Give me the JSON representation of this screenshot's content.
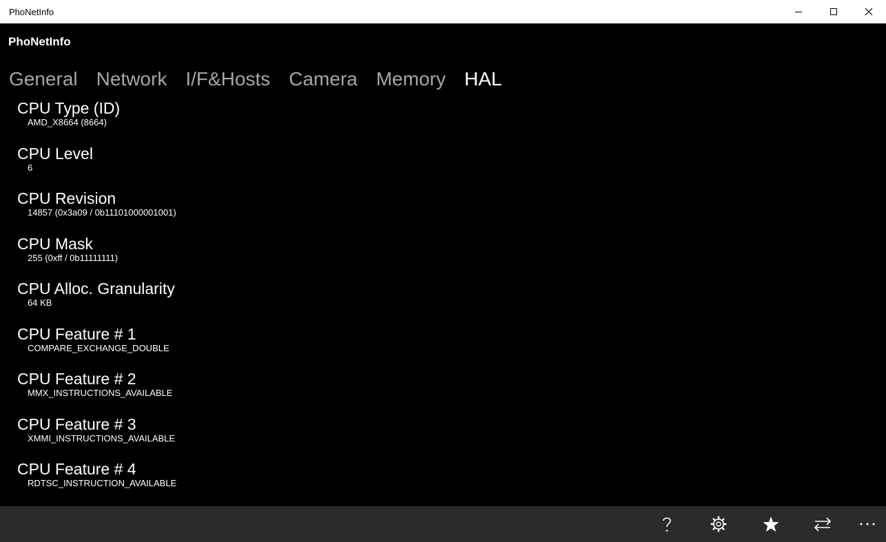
{
  "window": {
    "title": "PhoNetInfo"
  },
  "app": {
    "title": "PhoNetInfo"
  },
  "tabs": [
    {
      "label": "General"
    },
    {
      "label": "Network"
    },
    {
      "label": "I/F&Hosts"
    },
    {
      "label": "Camera"
    },
    {
      "label": "Memory"
    },
    {
      "label": "HAL"
    }
  ],
  "active_tab": "HAL",
  "items": [
    {
      "title": "CPU Type (ID)",
      "value": "AMD_X8664 (8664)"
    },
    {
      "title": "CPU Level",
      "value": "6"
    },
    {
      "title": "CPU Revision",
      "value": "14857 (0x3a09 / 0b11101000001001)"
    },
    {
      "title": "CPU Mask",
      "value": "255 (0xff / 0b11111111)"
    },
    {
      "title": "CPU Alloc. Granularity",
      "value": "64 KB"
    },
    {
      "title": "CPU Feature # 1",
      "value": "COMPARE_EXCHANGE_DOUBLE"
    },
    {
      "title": "CPU Feature # 2",
      "value": "MMX_INSTRUCTIONS_AVAILABLE"
    },
    {
      "title": "CPU Feature # 3",
      "value": "XMMI_INSTRUCTIONS_AVAILABLE"
    },
    {
      "title": "CPU Feature # 4",
      "value": "RDTSC_INSTRUCTION_AVAILABLE"
    }
  ],
  "appbar": {
    "icons": [
      "help-icon",
      "settings-icon",
      "favorite-icon",
      "swap-icon",
      "more-icon"
    ]
  },
  "colors": {
    "background": "#000000",
    "appbar": "#2b2b2b",
    "inactive_tab": "#a6a6a6",
    "titlebar": "#ffffff"
  }
}
